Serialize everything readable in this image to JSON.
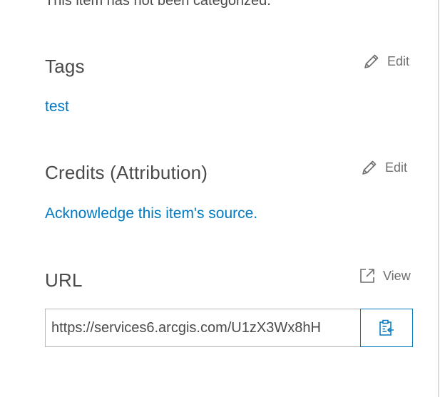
{
  "category_note": "This item has not been categorized.",
  "tags": {
    "title": "Tags",
    "edit_label": "Edit",
    "values": [
      "test"
    ]
  },
  "credits": {
    "title": "Credits (Attribution)",
    "edit_label": "Edit",
    "link_text": "Acknowledge this item's source."
  },
  "url": {
    "title": "URL",
    "view_label": "View",
    "value": "https://services6.arcgis.com/U1zX3Wx8hH"
  },
  "colors": {
    "link": "#0079c1",
    "text": "#4a4a4a",
    "muted": "#6e6e6e"
  }
}
